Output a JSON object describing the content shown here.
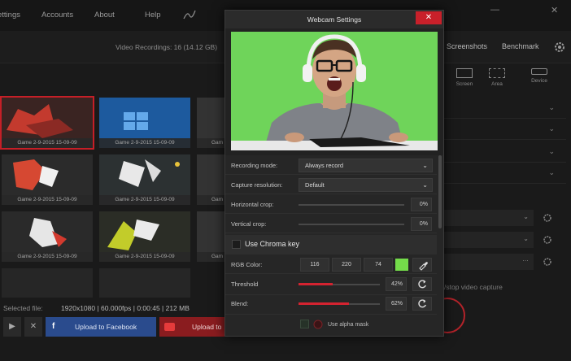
{
  "top_nav": {
    "items": [
      "ettings",
      "Accounts",
      "About",
      "Help"
    ],
    "window_controls": [
      "—",
      "✕"
    ]
  },
  "recordings": {
    "header": "Video Recordings: 16 (14.12 GB)",
    "items": [
      {
        "caption": "Game 2-9-2015 15-09-09",
        "selected": true
      },
      {
        "caption": "Game 2-9-2015 15-09-09",
        "selected": false
      },
      {
        "caption": "Gam",
        "selected": false
      },
      {
        "caption": "Game 2-9-2015 15-09-09",
        "selected": false
      },
      {
        "caption": "Game 2-9-2015 15-09-09",
        "selected": false
      },
      {
        "caption": "Gam",
        "selected": false
      },
      {
        "caption": "Game 2-9-2015 15-09-09",
        "selected": false
      },
      {
        "caption": "Game 2-9-2015 15-09-09",
        "selected": false
      },
      {
        "caption": "Gam",
        "selected": false
      }
    ]
  },
  "selected_file": {
    "label": "Selected file:",
    "info": "1920x1080 | 60.000fps | 0:00:45 | 212 MB"
  },
  "bottom_actions": {
    "play": "▶",
    "delete": "✕",
    "facebook_icon": "f",
    "facebook_label": "Upload to Facebook",
    "youtube_label": "Upload to"
  },
  "right_panel": {
    "tabs": [
      "Screenshots",
      "Benchmark"
    ],
    "sources": [
      "Screen",
      "Area",
      "Device"
    ],
    "stop_capture": "/stop video capture"
  },
  "modal": {
    "title": "Webcam Settings",
    "close": "✕",
    "recording_mode": {
      "label": "Recording mode:",
      "value": "Always record"
    },
    "capture_resolution": {
      "label": "Capture resolution:",
      "value": "Default"
    },
    "horizontal_crop": {
      "label": "Horizontal crop:",
      "value": "0%"
    },
    "vertical_crop": {
      "label": "Vertical crop:",
      "value": "0%"
    },
    "chroma_key": {
      "label": "Use Chroma key",
      "checked": false
    },
    "rgb_color": {
      "label": "RGB Color:",
      "r": "116",
      "g": "220",
      "b": "74",
      "swatch": "#74dc4a"
    },
    "threshold": {
      "label": "Threshold",
      "value": "42%",
      "level": 0.42
    },
    "blend": {
      "label": "Blend:",
      "value": "62%",
      "level": 0.62
    },
    "alpha_mask": {
      "label": "Use alpha mask",
      "checked": false
    }
  },
  "colors": {
    "accent_red": "#c8202a",
    "facebook_blue": "#2a4b8d",
    "chroma_green": "#6fd45a"
  }
}
